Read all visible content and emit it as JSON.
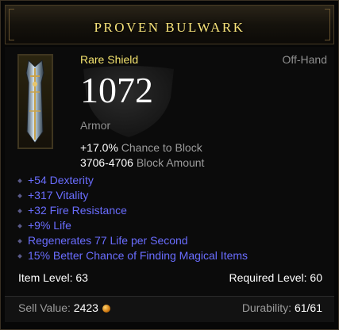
{
  "item": {
    "name": "PROVEN BULWARK",
    "quality": "Rare Shield",
    "slot": "Off-Hand",
    "armor_value": "1072",
    "armor_label": "Armor",
    "icon": "shield-icon"
  },
  "primary_stats": [
    {
      "value": "+17.0%",
      "text": "Chance to Block"
    },
    {
      "value": "3706-4706",
      "text": "Block Amount"
    }
  ],
  "affixes": [
    "+54 Dexterity",
    "+317 Vitality",
    "+32 Fire Resistance",
    "+9% Life",
    "Regenerates 77 Life per Second",
    "15% Better Chance of Finding Magical Items"
  ],
  "levels": {
    "item_level": "Item Level: 63",
    "required_level": "Required Level: 60"
  },
  "footer": {
    "sell_label": "Sell Value:",
    "sell_value": "2423",
    "durability_label": "Durability:",
    "durability_value": "61/61"
  },
  "colors": {
    "title": "#f7e37a",
    "rare": "#f4e36e",
    "magic_affix": "#6a6dff"
  }
}
